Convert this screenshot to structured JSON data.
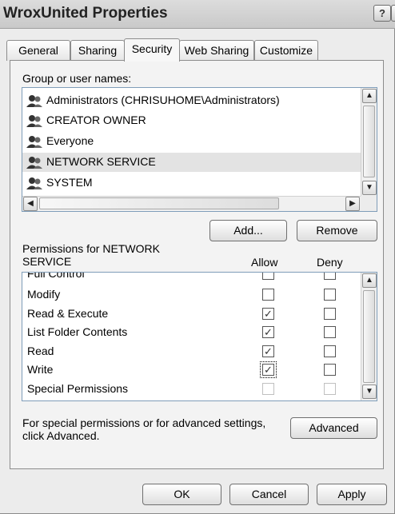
{
  "window": {
    "title": "WroxUnited Properties",
    "help_glyph": "?",
    "close_glyph": "✕"
  },
  "tabs": [
    {
      "label": "General"
    },
    {
      "label": "Sharing"
    },
    {
      "label": "Security"
    },
    {
      "label": "Web Sharing"
    },
    {
      "label": "Customize"
    }
  ],
  "active_tab": "Security",
  "users": {
    "label": "Group or user names:",
    "items": [
      {
        "name": "Administrators (CHRISUHOME\\Administrators)"
      },
      {
        "name": "CREATOR OWNER"
      },
      {
        "name": "Everyone"
      },
      {
        "name": "NETWORK SERVICE"
      },
      {
        "name": "SYSTEM"
      }
    ],
    "selected": "NETWORK SERVICE",
    "add_label": "Add...",
    "remove_label": "Remove"
  },
  "permissions": {
    "label": "Permissions for NETWORK SERVICE",
    "allow_label": "Allow",
    "deny_label": "Deny",
    "rows": [
      {
        "name": "Full Control",
        "allow": false,
        "deny": false
      },
      {
        "name": "Modify",
        "allow": false,
        "deny": false
      },
      {
        "name": "Read & Execute",
        "allow": true,
        "deny": false
      },
      {
        "name": "List Folder Contents",
        "allow": true,
        "deny": false
      },
      {
        "name": "Read",
        "allow": true,
        "deny": false
      },
      {
        "name": "Write",
        "allow": true,
        "deny": false
      },
      {
        "name": "Special Permissions",
        "allow": false,
        "deny": false
      }
    ]
  },
  "advanced": {
    "note": "For special permissions or for advanced settings, click Advanced.",
    "button_label": "Advanced"
  },
  "footer": {
    "ok_label": "OK",
    "cancel_label": "Cancel",
    "apply_label": "Apply"
  }
}
